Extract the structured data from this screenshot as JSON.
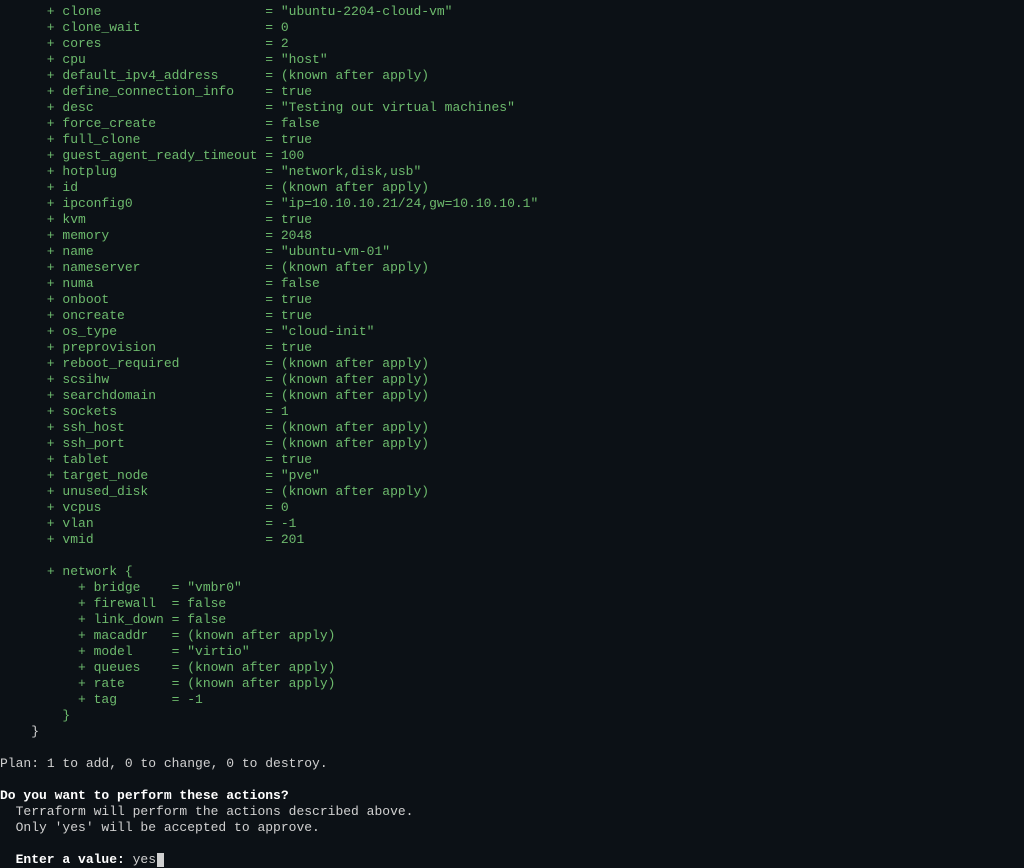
{
  "attributes": [
    {
      "key": "clone",
      "value": "\"ubuntu-2204-cloud-vm\""
    },
    {
      "key": "clone_wait",
      "value": "0"
    },
    {
      "key": "cores",
      "value": "2"
    },
    {
      "key": "cpu",
      "value": "\"host\""
    },
    {
      "key": "default_ipv4_address",
      "value": "(known after apply)"
    },
    {
      "key": "define_connection_info",
      "value": "true"
    },
    {
      "key": "desc",
      "value": "\"Testing out virtual machines\""
    },
    {
      "key": "force_create",
      "value": "false"
    },
    {
      "key": "full_clone",
      "value": "true"
    },
    {
      "key": "guest_agent_ready_timeout",
      "value": "100"
    },
    {
      "key": "hotplug",
      "value": "\"network,disk,usb\""
    },
    {
      "key": "id",
      "value": "(known after apply)"
    },
    {
      "key": "ipconfig0",
      "value": "\"ip=10.10.10.21/24,gw=10.10.10.1\""
    },
    {
      "key": "kvm",
      "value": "true"
    },
    {
      "key": "memory",
      "value": "2048"
    },
    {
      "key": "name",
      "value": "\"ubuntu-vm-01\""
    },
    {
      "key": "nameserver",
      "value": "(known after apply)"
    },
    {
      "key": "numa",
      "value": "false"
    },
    {
      "key": "onboot",
      "value": "true"
    },
    {
      "key": "oncreate",
      "value": "true"
    },
    {
      "key": "os_type",
      "value": "\"cloud-init\""
    },
    {
      "key": "preprovision",
      "value": "true"
    },
    {
      "key": "reboot_required",
      "value": "(known after apply)"
    },
    {
      "key": "scsihw",
      "value": "(known after apply)"
    },
    {
      "key": "searchdomain",
      "value": "(known after apply)"
    },
    {
      "key": "sockets",
      "value": "1"
    },
    {
      "key": "ssh_host",
      "value": "(known after apply)"
    },
    {
      "key": "ssh_port",
      "value": "(known after apply)"
    },
    {
      "key": "tablet",
      "value": "true"
    },
    {
      "key": "target_node",
      "value": "\"pve\""
    },
    {
      "key": "unused_disk",
      "value": "(known after apply)"
    },
    {
      "key": "vcpus",
      "value": "0"
    },
    {
      "key": "vlan",
      "value": "-1"
    },
    {
      "key": "vmid",
      "value": "201"
    }
  ],
  "network_header": "network {",
  "network_attributes": [
    {
      "key": "bridge",
      "value": "\"vmbr0\""
    },
    {
      "key": "firewall",
      "value": "false"
    },
    {
      "key": "link_down",
      "value": "false"
    },
    {
      "key": "macaddr",
      "value": "(known after apply)"
    },
    {
      "key": "model",
      "value": "\"virtio\""
    },
    {
      "key": "queues",
      "value": "(known after apply)"
    },
    {
      "key": "rate",
      "value": "(known after apply)"
    },
    {
      "key": "tag",
      "value": "-1"
    }
  ],
  "network_close": "        }",
  "resource_close": "    }",
  "plan_label": "Plan:",
  "plan_text": " 1 to add, 0 to change, 0 to destroy.",
  "confirm_header": "Do you want to perform these actions?",
  "confirm_line1": "  Terraform will perform the actions described above.",
  "confirm_line2": "  Only 'yes' will be accepted to approve.",
  "enter_label": "  Enter a value:",
  "enter_value": " yes"
}
